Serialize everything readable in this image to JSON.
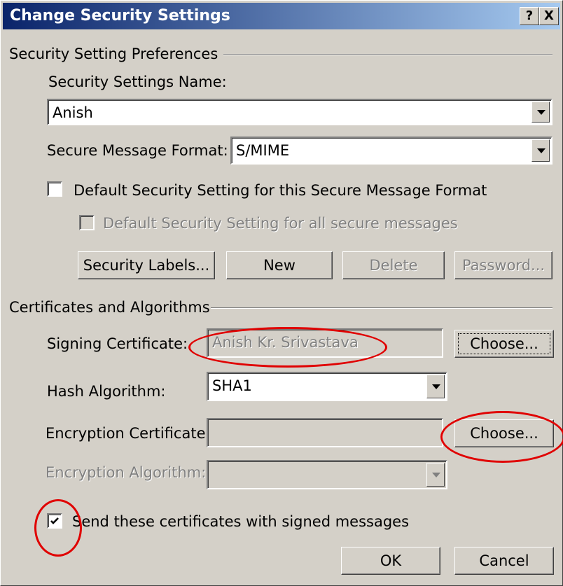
{
  "window": {
    "title": "Change Security Settings",
    "help_label": "?",
    "close_label": "X"
  },
  "prefs": {
    "group_label": "Security Setting Preferences",
    "name_label": "Security Settings Name:",
    "name_value": "Anish",
    "format_label": "Secure Message Format:",
    "format_value": "S/MIME",
    "default_format_label": "Default Security Setting for this Secure Message Format",
    "default_format_checked": false,
    "default_all_label": "Default Security Setting for all secure messages",
    "default_all_checked": false,
    "buttons": {
      "security_labels": "Security Labels...",
      "new": "New",
      "delete": "Delete",
      "password": "Password..."
    }
  },
  "certs": {
    "group_label": "Certificates and Algorithms",
    "signing_label": "Signing Certificate:",
    "signing_value": "Anish Kr. Srivastava",
    "signing_choose": "Choose...",
    "hash_label": "Hash Algorithm:",
    "hash_value": "SHA1",
    "encryption_label": "Encryption Certificate:",
    "encryption_value": "",
    "encryption_choose": "Choose...",
    "enc_alg_label": "Encryption Algorithm:",
    "enc_alg_value": "",
    "send_certs_label": "Send these certificates with signed messages",
    "send_certs_checked": true
  },
  "footer": {
    "ok": "OK",
    "cancel": "Cancel"
  },
  "colors": {
    "title_start": "#0a246a",
    "title_end": "#a6caf0",
    "annotation": "#e00000"
  }
}
